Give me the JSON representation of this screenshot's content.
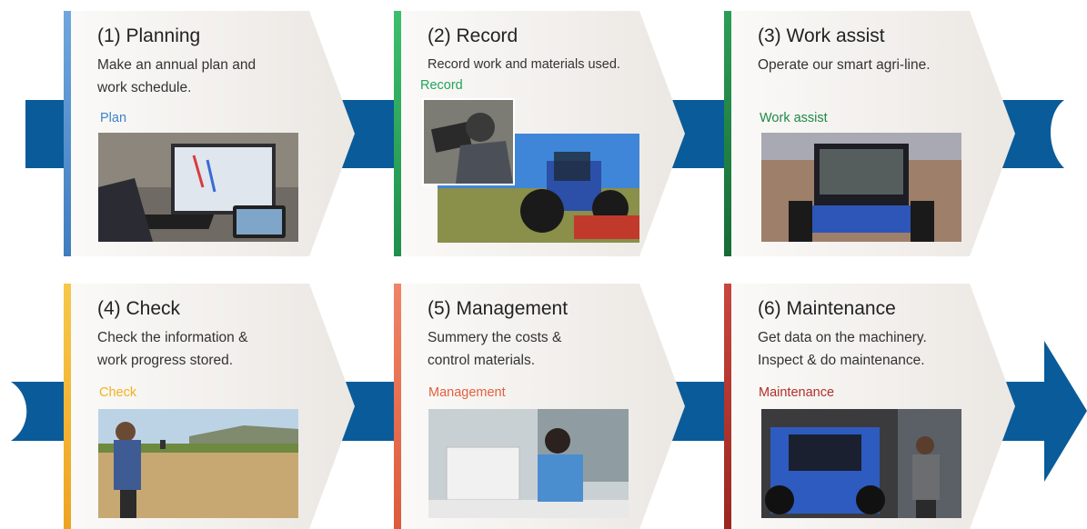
{
  "steps": [
    {
      "title": "(1) Planning",
      "desc": [
        "Make an annual plan and",
        "work schedule."
      ],
      "tag": "Plan",
      "color": "#4a86c5",
      "photo": "office-computer-photo"
    },
    {
      "title": "(2) Record",
      "desc": [
        "Record work and materials used."
      ],
      "tag": "Record",
      "color": "#2aa35a",
      "photo": "tractor-tablet-photo"
    },
    {
      "title": "(3) Work assist",
      "desc": [
        "Operate our smart agri-line."
      ],
      "tag": "Work assist",
      "color": "#218a45",
      "photo": "tractor-field-photo"
    },
    {
      "title": "(4) Check",
      "desc": [
        "Check the information &",
        "work progress stored."
      ],
      "tag": "Check",
      "color": "#f2b531",
      "photo": "farmer-field-photo"
    },
    {
      "title": "(5) Management",
      "desc": [
        "Summery the costs &",
        "control materials."
      ],
      "tag": "Management",
      "color": "#e86a4a",
      "photo": "office-desk-photo"
    },
    {
      "title": "(6) Maintenance",
      "desc": [
        "Get data on the machinery.",
        "Inspect & do maintenance."
      ],
      "tag": "Maintenance",
      "color": "#b8322d",
      "photo": "garage-tractor-photo"
    }
  ],
  "colors": {
    "arrow": "#0a5b99",
    "card": "#f2efec"
  }
}
